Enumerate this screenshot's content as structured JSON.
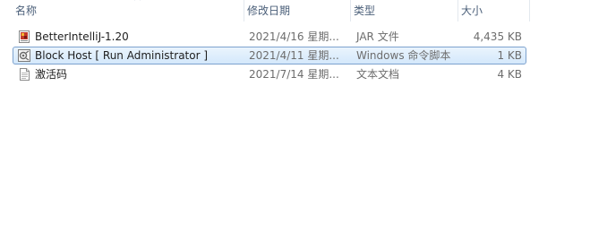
{
  "columns": {
    "name": "名称",
    "modified": "修改日期",
    "type": "类型",
    "size": "大小"
  },
  "files": [
    {
      "name": "BetterIntelliJ-1.20",
      "modified": "2021/4/16 星期...",
      "type": "JAR 文件",
      "size": "4,435 KB",
      "icon": "jar-file-icon",
      "selected": false
    },
    {
      "name": "Block Host [ Run Administrator ]",
      "modified": "2021/4/11 星期...",
      "type": "Windows 命令脚本",
      "size": "1 KB",
      "icon": "batch-script-icon",
      "selected": true
    },
    {
      "name": "激活码",
      "modified": "2021/7/14 星期...",
      "type": "文本文档",
      "size": "4 KB",
      "icon": "text-document-icon",
      "selected": false
    }
  ],
  "colors": {
    "header_text": "#4c607a",
    "selection_border": "#7da2ce",
    "selection_fill": "#d4e8fb",
    "secondary_text": "#6d6d6d"
  }
}
